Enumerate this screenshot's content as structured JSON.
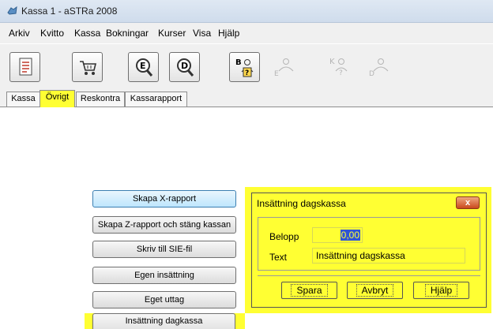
{
  "window": {
    "title": "Kassa 1 - aSTRa 2008"
  },
  "menu": [
    "Arkiv",
    "Kvitto",
    "Kassa",
    "Bokningar",
    "Kurser",
    "Visa",
    "Hjälp"
  ],
  "toolbar": {
    "icons": [
      "receipt-icon",
      "cart-icon",
      "search-e-icon",
      "search-d-icon",
      "person-b-e-icon",
      "person-e-icon",
      "person-k-icon",
      "person-d-icon"
    ]
  },
  "tabs": [
    "Kassa",
    "Övrigt",
    "Reskontra",
    "Kassarapport"
  ],
  "actions": [
    "Skapa X-rapport",
    "Skapa Z-rapport och stäng kassan",
    "Skriv till SIE-fil",
    "Egen insättning",
    "Eget uttag",
    "Insättning dagkassa"
  ],
  "dialog": {
    "title": "Insättning dagskassa",
    "close_label": "x",
    "belopp_label": "Belopp",
    "belopp_value": "0,00",
    "text_label": "Text",
    "text_value": "Insättning dagskassa",
    "save": "Spara",
    "cancel": "Avbryt",
    "help": "Hjälp"
  },
  "colors": {
    "highlight": "#ffff33",
    "selection": "#2f54d6"
  }
}
